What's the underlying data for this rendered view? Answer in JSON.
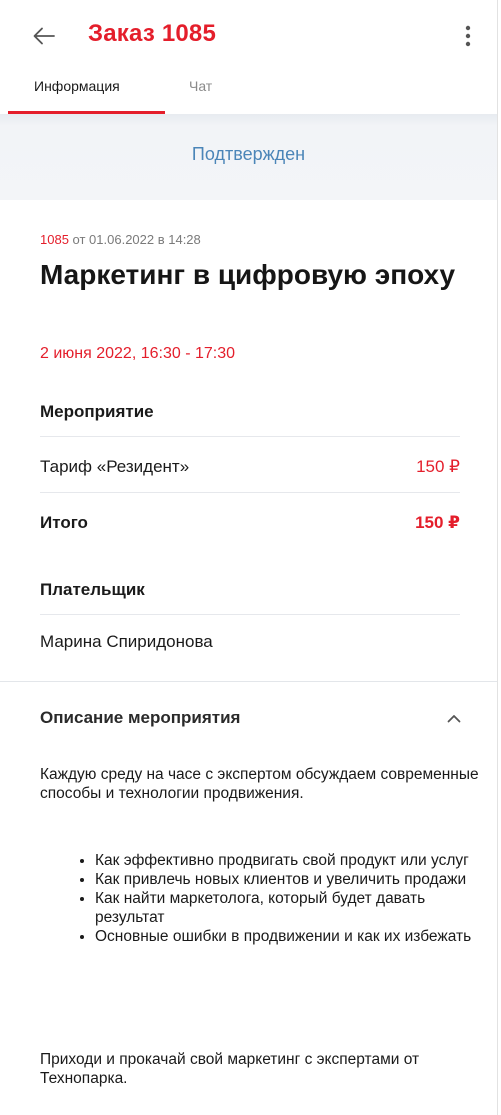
{
  "header": {
    "title": "Заказ 1085",
    "back_icon": "arrow-left-icon",
    "more_icon": "more-vertical-icon"
  },
  "tabs": [
    {
      "label": "Информация",
      "active": true
    },
    {
      "label": "Чат",
      "active": false
    }
  ],
  "status": "Подтвержден",
  "order": {
    "number": "1085",
    "meta_rest": " от 01.06.2022 в 14:28",
    "event_title": "Маркетинг в цифровую эпоху",
    "event_date": "2 июня 2022, 16:30 - 17:30"
  },
  "event_section": {
    "label": "Мероприятие",
    "tariff_label": "Тариф «Резидент»",
    "tariff_price": "150 ₽",
    "total_label": "Итого",
    "total_price": "150 ₽"
  },
  "payer_section": {
    "label": "Плательщик",
    "name": "Марина Спиридонова"
  },
  "description": {
    "header": "Описание мероприятия",
    "chevron_icon": "chevron-up-icon",
    "intro": "Каждую среду на часе с экспертом обсуждаем современные способы и технологии продвижения.",
    "items": [
      "Как эффективно продвигать свой продукт или услуг",
      "Как привлечь новых клиентов и увеличить продажи",
      "Как найти маркетолога, который будет давать результат",
      "Основные ошибки в продвижении и как их избежать"
    ],
    "outro": "Приходи и прокачай свой маркетинг с экспертами от Технопарка."
  },
  "colors": {
    "accent": "#e41e2b",
    "status": "#4b85b8"
  }
}
